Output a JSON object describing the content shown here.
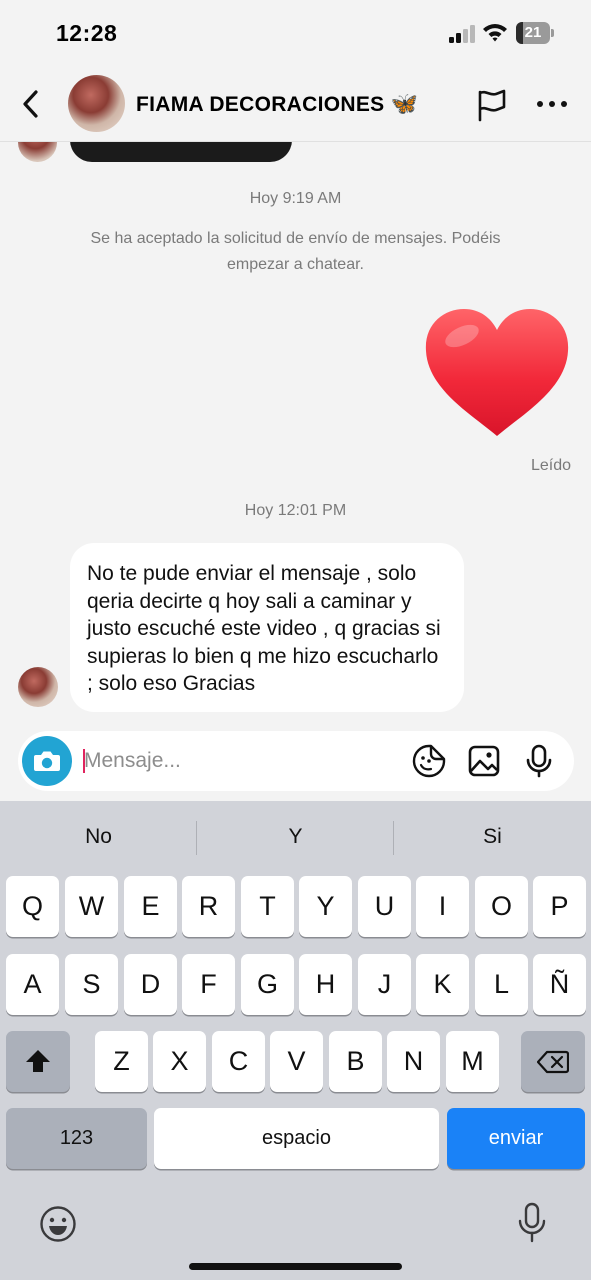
{
  "status_bar": {
    "time": "12:28",
    "battery_text": "21",
    "battery_level": 0.21
  },
  "header": {
    "contact_name": "FIAMA DECORACIONES",
    "name_emoji": "🦋"
  },
  "conversation": {
    "timestamp_1": "Hoy 9:19 AM",
    "system_message": "Se ha aceptado la solicitud de envío de mensajes. Podéis empezar a chatear.",
    "sent_reaction": "heart",
    "seen_label": "Leído",
    "timestamp_2": "Hoy 12:01 PM",
    "received_message": "No te pude enviar el mensaje , solo qeria decirte q hoy sali a caminar y justo escuché este video , q gracias si supieras lo bien q me hizo escucharlo ; solo eso Gracias"
  },
  "composer": {
    "placeholder": "Mensaje...",
    "accent_color": "#22a4d3"
  },
  "keyboard": {
    "suggestions": [
      "No",
      "Y",
      "Si"
    ],
    "row1": [
      "Q",
      "W",
      "E",
      "R",
      "T",
      "Y",
      "U",
      "I",
      "O",
      "P"
    ],
    "row2": [
      "A",
      "S",
      "D",
      "F",
      "G",
      "H",
      "J",
      "K",
      "L",
      "Ñ"
    ],
    "row3": [
      "Z",
      "X",
      "C",
      "V",
      "B",
      "N",
      "M"
    ],
    "numbers_key": "123",
    "space_key": "espacio",
    "send_key": "enviar",
    "send_color": "#1a82f7"
  }
}
